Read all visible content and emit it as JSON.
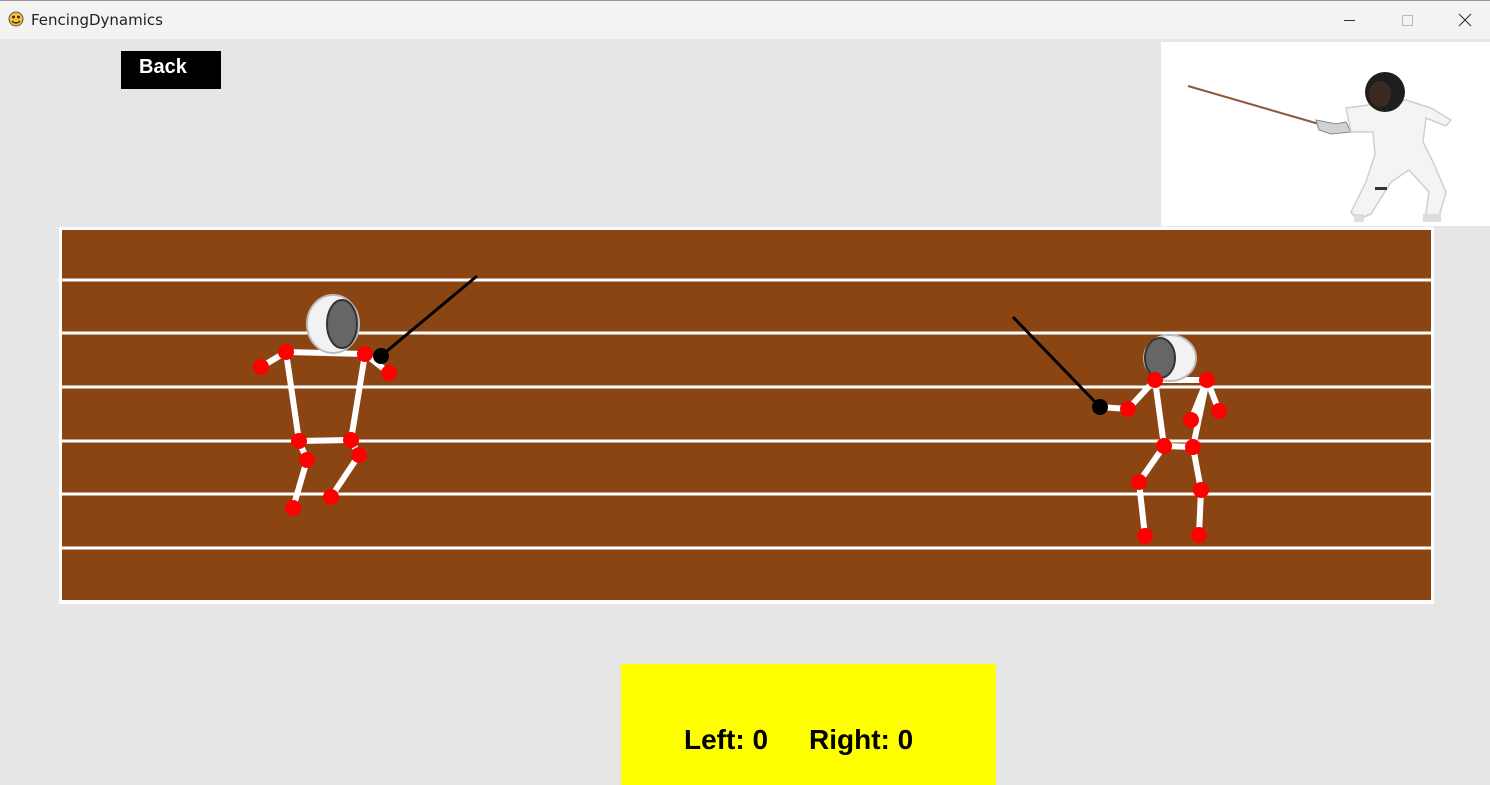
{
  "window": {
    "title": "FencingDynamics",
    "icons": {
      "app": "pygame-snake-icon",
      "minimize": "minimize-icon",
      "maximize": "maximize-icon",
      "close": "close-icon"
    }
  },
  "toolbar": {
    "back_label": "Back"
  },
  "scoreboard": {
    "left_label": "Left:",
    "left_score": "0",
    "right_label": "Right:",
    "right_score": "0"
  },
  "colors": {
    "background": "#e6e6e6",
    "piste": "#8b4513",
    "lane_line": "#ffffff",
    "joint": "#ff0000",
    "limb": "#ffffff",
    "sword": "#000000",
    "score_box": "#ffff00",
    "back_button": "#000000"
  }
}
